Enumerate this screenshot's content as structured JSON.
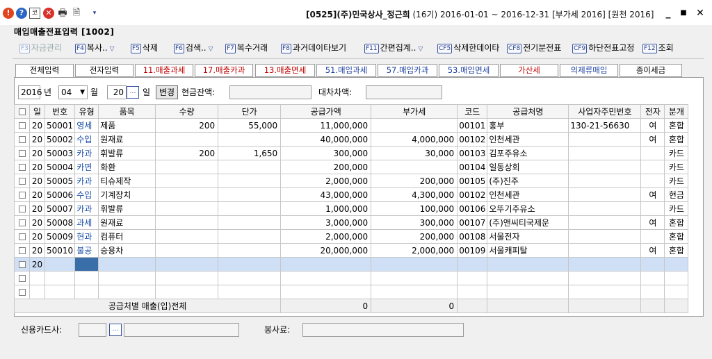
{
  "window": {
    "company_code": "[0525]",
    "company_name": "(주)민국상사_정근희",
    "fiscal_period": "(16기) 2016-01-01 ~ 2016-12-31",
    "vat_year": "[부가세 2016]",
    "withholding_year": "[원천 2016]",
    "minimize_label": "_",
    "maximize_label": "■",
    "close_label": "✕"
  },
  "screen_title": "매입매출전표입력 [1002]",
  "toolbar": [
    {
      "key": "F3",
      "label": "자금관리",
      "disabled": true,
      "dropdown": false
    },
    {
      "key": "F4",
      "label": "복사..",
      "disabled": false,
      "dropdown": true
    },
    {
      "key": "F5",
      "label": "삭제",
      "disabled": false,
      "dropdown": false
    },
    {
      "key": "F6",
      "label": "검색..",
      "disabled": false,
      "dropdown": true
    },
    {
      "key": "F7",
      "label": "복수거래",
      "disabled": false,
      "dropdown": false
    },
    {
      "key": "F8",
      "label": "과거데이타보기",
      "disabled": false,
      "dropdown": false
    },
    {
      "key": "F11",
      "label": "간편집계..",
      "disabled": false,
      "dropdown": true
    },
    {
      "key": "CF5",
      "label": "삭제한데이타",
      "disabled": false,
      "dropdown": false
    },
    {
      "key": "CF8",
      "label": "전기분전표",
      "disabled": false,
      "dropdown": false
    },
    {
      "key": "CF9",
      "label": "하단전표고정",
      "disabled": false,
      "dropdown": false
    },
    {
      "key": "F12",
      "label": "조회",
      "disabled": false,
      "dropdown": false
    }
  ],
  "tabs": [
    {
      "label": "전체입력",
      "active": true,
      "color": "black"
    },
    {
      "label": "전자입력",
      "active": false,
      "color": "black"
    },
    {
      "label": "11.매출과세",
      "active": false,
      "color": "red"
    },
    {
      "label": "17.매출카과",
      "active": false,
      "color": "red"
    },
    {
      "label": "13.매출면세",
      "active": false,
      "color": "red"
    },
    {
      "label": "51.매입과세",
      "active": false,
      "color": "blue"
    },
    {
      "label": "57.매입카과",
      "active": false,
      "color": "blue"
    },
    {
      "label": "53.매입면세",
      "active": false,
      "color": "blue"
    },
    {
      "label": "가산세",
      "active": false,
      "color": "red"
    },
    {
      "label": "의제류매입",
      "active": false,
      "color": "blue"
    },
    {
      "label": "종이세금",
      "active": false,
      "color": "black"
    }
  ],
  "date_row": {
    "year": "2016",
    "year_label": "년",
    "month": "04",
    "month_label": "월",
    "day": "20",
    "day_label": "일",
    "change_button": "변경",
    "cash_balance_label": "현금잔액:",
    "cash_balance_value": "",
    "difference_label": "대차차액:",
    "difference_value": ""
  },
  "grid": {
    "headers": [
      "일",
      "번호",
      "유형",
      "품목",
      "수량",
      "단가",
      "공급가액",
      "부가세",
      "코드",
      "공급처명",
      "사업자주민번호",
      "전자",
      "분개"
    ],
    "rows": [
      {
        "day": "20",
        "no": "50001",
        "type": "영세",
        "item": "제품",
        "qty": "200",
        "price": "55,000",
        "supply": "11,000,000",
        "vat": "",
        "code": "00101",
        "vendor": "홍부",
        "bizno": "130-21-56630",
        "elec": "여",
        "journal": "혼합"
      },
      {
        "day": "20",
        "no": "50002",
        "type": "수입",
        "item": "원재료",
        "qty": "",
        "price": "",
        "supply": "40,000,000",
        "vat": "4,000,000",
        "code": "00102",
        "vendor": "인천세관",
        "bizno": "",
        "elec": "여",
        "journal": "혼합"
      },
      {
        "day": "20",
        "no": "50003",
        "type": "카과",
        "item": "휘발류",
        "qty": "200",
        "price": "1,650",
        "supply": "300,000",
        "vat": "30,000",
        "code": "00103",
        "vendor": "김포주유소",
        "bizno": "",
        "elec": "",
        "journal": "카드"
      },
      {
        "day": "20",
        "no": "50004",
        "type": "카면",
        "item": "화환",
        "qty": "",
        "price": "",
        "supply": "200,000",
        "vat": "",
        "code": "00104",
        "vendor": "일동상회",
        "bizno": "",
        "elec": "",
        "journal": "카드"
      },
      {
        "day": "20",
        "no": "50005",
        "type": "카과",
        "item": "티슈제작",
        "qty": "",
        "price": "",
        "supply": "2,000,000",
        "vat": "200,000",
        "code": "00105",
        "vendor": "(주)진주",
        "bizno": "",
        "elec": "",
        "journal": "카드"
      },
      {
        "day": "20",
        "no": "50006",
        "type": "수입",
        "item": "기계장치",
        "qty": "",
        "price": "",
        "supply": "43,000,000",
        "vat": "4,300,000",
        "code": "00102",
        "vendor": "인천세관",
        "bizno": "",
        "elec": "여",
        "journal": "현금"
      },
      {
        "day": "20",
        "no": "50007",
        "type": "카과",
        "item": "휘발류",
        "qty": "",
        "price": "",
        "supply": "1,000,000",
        "vat": "100,000",
        "code": "00106",
        "vendor": "오뚜기주유소",
        "bizno": "",
        "elec": "",
        "journal": "카드"
      },
      {
        "day": "20",
        "no": "50008",
        "type": "과세",
        "item": "원재료",
        "qty": "",
        "price": "",
        "supply": "3,000,000",
        "vat": "300,000",
        "code": "00107",
        "vendor": "(주)앤씨티국제운",
        "bizno": "",
        "elec": "여",
        "journal": "혼합"
      },
      {
        "day": "20",
        "no": "50009",
        "type": "현과",
        "item": "컴퓨터",
        "qty": "",
        "price": "",
        "supply": "2,000,000",
        "vat": "200,000",
        "code": "00108",
        "vendor": "서울전자",
        "bizno": "",
        "elec": "",
        "journal": "혼합"
      },
      {
        "day": "20",
        "no": "50010",
        "type": "불공",
        "item": "승용차",
        "qty": "",
        "price": "",
        "supply": "20,000,000",
        "vat": "2,000,000",
        "code": "00109",
        "vendor": "서울캐피탈",
        "bizno": "",
        "elec": "여",
        "journal": "혼합"
      }
    ],
    "new_row_day": "20",
    "total_label": "공급처별 매출(입)전체",
    "total_supply": "0",
    "total_vat": "0"
  },
  "bottom": {
    "credit_card_label": "신용카드사:",
    "service_fee_label": "봉사료:"
  },
  "colors": {
    "selected_row": "#cfe0f6",
    "current_cell": "#3a6ea8",
    "type_text": "#1a50a8",
    "tab_red": "#c00000",
    "tab_blue": "#1a3ea0"
  }
}
